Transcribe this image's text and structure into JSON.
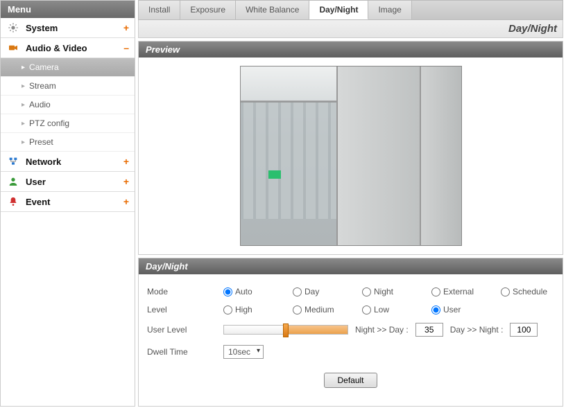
{
  "sidebar": {
    "title": "Menu",
    "sections": [
      {
        "label": "System",
        "expander": "+"
      },
      {
        "label": "Audio & Video",
        "expander": "–"
      },
      {
        "label": "Network",
        "expander": "+"
      },
      {
        "label": "User",
        "expander": "+"
      },
      {
        "label": "Event",
        "expander": "+"
      }
    ],
    "submenu": [
      {
        "label": "Camera"
      },
      {
        "label": "Stream"
      },
      {
        "label": "Audio"
      },
      {
        "label": "PTZ config"
      },
      {
        "label": "Preset"
      }
    ]
  },
  "tabs": [
    {
      "label": "Install"
    },
    {
      "label": "Exposure"
    },
    {
      "label": "White Balance"
    },
    {
      "label": "Day/Night"
    },
    {
      "label": "Image"
    }
  ],
  "breadcrumb": "Day/Night",
  "panels": {
    "preview_title": "Preview",
    "settings_title": "Day/Night"
  },
  "form": {
    "mode_label": "Mode",
    "mode_options": [
      "Auto",
      "Day",
      "Night",
      "External",
      "Schedule"
    ],
    "mode_selected": "Auto",
    "level_label": "Level",
    "level_options": [
      "High",
      "Medium",
      "Low",
      "User"
    ],
    "level_selected": "User",
    "userlevel_label": "User Level",
    "night_to_day_label": "Night >> Day :",
    "night_to_day_value": "35",
    "day_to_night_label": "Day >> Night :",
    "day_to_night_value": "100",
    "dwell_label": "Dwell Time",
    "dwell_value": "10sec",
    "default_button": "Default"
  }
}
